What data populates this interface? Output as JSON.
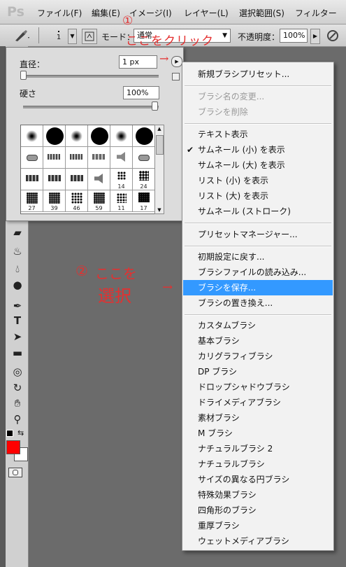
{
  "app": {
    "logo": "Ps"
  },
  "menubar": {
    "items": [
      "ファイル(F)",
      "編集(E)",
      "イメージ(I)",
      "レイヤー(L)",
      "選択範囲(S)",
      "フィルター"
    ]
  },
  "options": {
    "brush_size": "1",
    "mode_label": "モード：",
    "mode_value": "通常",
    "opacity_label": "不透明度：",
    "opacity_value": "100%"
  },
  "brush_panel": {
    "diameter_label": "直径：",
    "diameter_value": "1 px",
    "hardness_label": "硬さ",
    "hardness_value": "100%",
    "diameter_slider_fraction": 0.0,
    "hardness_slider_fraction": 1.0,
    "preset_labels": [
      "14",
      "24",
      "27",
      "39",
      "46",
      "59",
      "11",
      "17"
    ]
  },
  "context_menu": {
    "items": [
      {
        "label": "新規ブラシプリセット...",
        "state": "normal"
      },
      {
        "label": "ブラシ名の変更...",
        "state": "disabled"
      },
      {
        "label": "ブラシを削除",
        "state": "disabled"
      },
      {
        "label": "テキスト表示",
        "state": "normal"
      },
      {
        "label": "サムネール (小) を表示",
        "state": "checked"
      },
      {
        "label": "サムネール (大) を表示",
        "state": "normal"
      },
      {
        "label": "リスト (小) を表示",
        "state": "normal"
      },
      {
        "label": "リスト (大) を表示",
        "state": "normal"
      },
      {
        "label": "サムネール (ストローク)",
        "state": "normal"
      },
      {
        "label": "プリセットマネージャー...",
        "state": "normal"
      },
      {
        "label": "初期設定に戻す...",
        "state": "normal"
      },
      {
        "label": "ブラシファイルの読み込み...",
        "state": "normal"
      },
      {
        "label": "ブラシを保存...",
        "state": "highlighted"
      },
      {
        "label": "ブラシの置き換え...",
        "state": "normal"
      },
      {
        "label": "カスタムブラシ",
        "state": "normal"
      },
      {
        "label": "基本ブラシ",
        "state": "normal"
      },
      {
        "label": "カリグラフィブラシ",
        "state": "normal"
      },
      {
        "label": "DP ブラシ",
        "state": "normal"
      },
      {
        "label": "ドロップシャドウブラシ",
        "state": "normal"
      },
      {
        "label": "ドライメディアブラシ",
        "state": "normal"
      },
      {
        "label": "素材ブラシ",
        "state": "normal"
      },
      {
        "label": "M ブラシ",
        "state": "normal"
      },
      {
        "label": "ナチュラルブラシ 2",
        "state": "normal"
      },
      {
        "label": "ナチュラルブラシ",
        "state": "normal"
      },
      {
        "label": "サイズの異なる円ブラシ",
        "state": "normal"
      },
      {
        "label": "特殊効果ブラシ",
        "state": "normal"
      },
      {
        "label": "四角形のブラシ",
        "state": "normal"
      },
      {
        "label": "重厚ブラシ",
        "state": "normal"
      },
      {
        "label": "ウェットメディアブラシ",
        "state": "normal"
      }
    ]
  },
  "annotations": {
    "step1_number": "①",
    "step1_text": "ここをクリック",
    "step2_number": "②",
    "step2_text_line1": "ここを",
    "step2_text_line2": "選択",
    "arrow": "→"
  },
  "colors": {
    "highlight": "#3399ff",
    "annotation": "#e43030",
    "foreground": "#ff0000",
    "background": "#ffffff"
  }
}
